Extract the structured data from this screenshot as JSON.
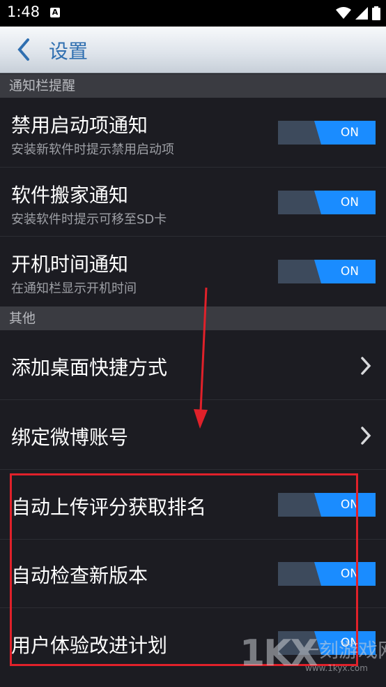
{
  "status_bar": {
    "time": "1:48",
    "notification_icon": "a-letter-icon",
    "icons": [
      "wifi-icon",
      "signal-icon",
      "battery-icon"
    ]
  },
  "app_bar": {
    "back_icon": "back-chevron-icon",
    "title": "设置"
  },
  "sections": {
    "notifications": {
      "header": "通知栏提醒",
      "items": [
        {
          "title": "禁用启动项通知",
          "subtitle": "安装新软件时提示禁用启动项",
          "toggle": "ON"
        },
        {
          "title": "软件搬家通知",
          "subtitle": "安装软件时提示可移至SD卡",
          "toggle": "ON"
        },
        {
          "title": "开机时间通知",
          "subtitle": "在通知栏显示开机时间",
          "toggle": "ON"
        }
      ]
    },
    "other": {
      "header": "其他",
      "items": [
        {
          "title": "添加桌面快捷方式"
        },
        {
          "title": "绑定微博账号"
        },
        {
          "title": "自动上传评分获取排名",
          "toggle": "ON"
        },
        {
          "title": "自动检查新版本",
          "toggle": "ON"
        },
        {
          "title": "用户体验改进计划",
          "toggle": "ON"
        }
      ]
    }
  },
  "watermark": {
    "logo": "1KX",
    "name": "一刻游戏网",
    "url": "www.1kyx.com"
  },
  "colors": {
    "toggle_on": "#1a8cff",
    "toggle_track": "#3d4a5c",
    "annotation": "#e0212a",
    "title_blue": "#2f6fb0"
  }
}
